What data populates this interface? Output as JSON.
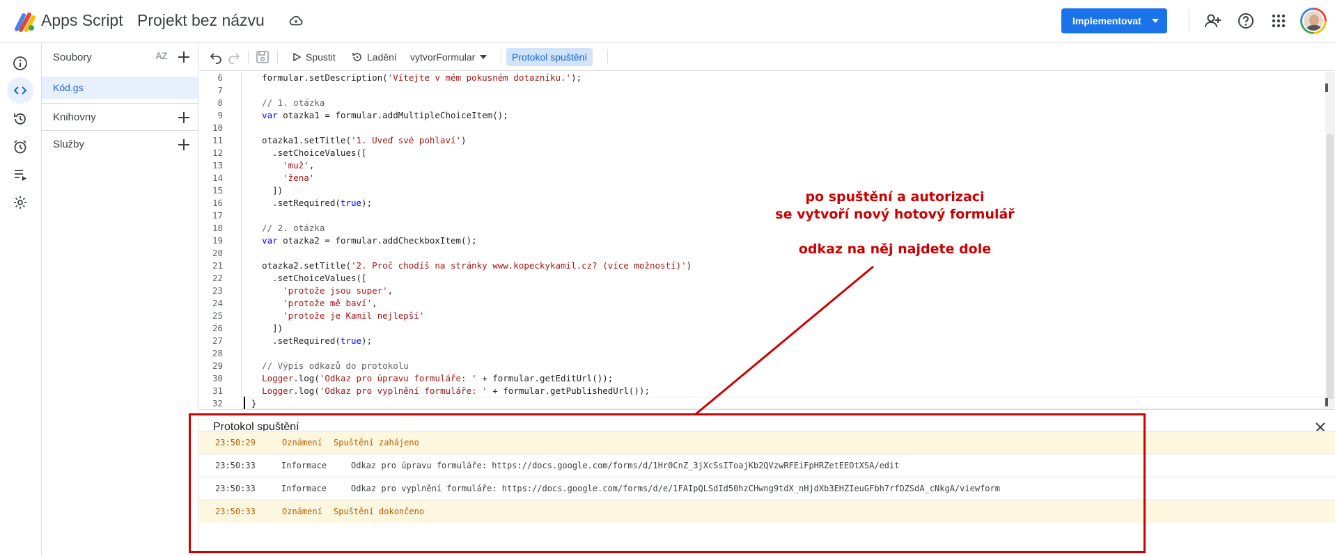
{
  "topbar": {
    "app_name": "Apps Script",
    "project_title": "Projekt bez názvu",
    "deploy_label": "Implementovat"
  },
  "colors": {
    "accent": "#1a73e8",
    "annotation": "#cc0000",
    "notice_row_bg": "#fef7e0",
    "notice_text": "#b06000",
    "string": "#a31515",
    "keyword": "#0000ff"
  },
  "rail": {
    "icons": [
      "info-icon",
      "code-icon",
      "history-icon",
      "alarm-icon",
      "executions-icon",
      "settings-icon"
    ]
  },
  "files": {
    "title": "Soubory",
    "sort_icon_text": "AZ",
    "items": [
      {
        "name": "Kód.gs"
      }
    ],
    "sections": [
      {
        "label": "Knihovny"
      },
      {
        "label": "Služby"
      }
    ]
  },
  "toolbar": {
    "run_label": "Spustit",
    "debug_label": "Ladění",
    "function_select": "vytvorFormular",
    "log_toggle_label": "Protokol spuštění"
  },
  "code": {
    "lines": [
      {
        "n": "6",
        "parts": [
          {
            "t": "  formular.setDescription(",
            "c": ""
          },
          {
            "t": "'Vítejte v mém pokusném dotazníku.'",
            "c": "str"
          },
          {
            "t": ");",
            "c": ""
          }
        ]
      },
      {
        "n": "7",
        "parts": []
      },
      {
        "n": "8",
        "parts": [
          {
            "t": "  // 1. otázka",
            "c": "cmt"
          }
        ]
      },
      {
        "n": "9",
        "parts": [
          {
            "t": "  ",
            "c": ""
          },
          {
            "t": "var",
            "c": "kw"
          },
          {
            "t": " otazka1 = formular.addMultipleChoiceItem();",
            "c": ""
          }
        ]
      },
      {
        "n": "10",
        "parts": []
      },
      {
        "n": "11",
        "parts": [
          {
            "t": "  otazka1.setTitle(",
            "c": ""
          },
          {
            "t": "'1. Uveď své pohlaví'",
            "c": "str"
          },
          {
            "t": ")",
            "c": ""
          }
        ]
      },
      {
        "n": "12",
        "parts": [
          {
            "t": "    .setChoiceValues([",
            "c": ""
          }
        ]
      },
      {
        "n": "13",
        "parts": [
          {
            "t": "      ",
            "c": ""
          },
          {
            "t": "'muž'",
            "c": "str"
          },
          {
            "t": ",",
            "c": ""
          }
        ]
      },
      {
        "n": "14",
        "parts": [
          {
            "t": "      ",
            "c": ""
          },
          {
            "t": "'žena'",
            "c": "str"
          }
        ]
      },
      {
        "n": "15",
        "parts": [
          {
            "t": "    ])",
            "c": ""
          }
        ]
      },
      {
        "n": "16",
        "parts": [
          {
            "t": "    .setRequired(",
            "c": ""
          },
          {
            "t": "true",
            "c": "kw"
          },
          {
            "t": ");",
            "c": ""
          }
        ]
      },
      {
        "n": "17",
        "parts": []
      },
      {
        "n": "18",
        "parts": [
          {
            "t": "  // 2. otázka",
            "c": "cmt"
          }
        ]
      },
      {
        "n": "19",
        "parts": [
          {
            "t": "  ",
            "c": ""
          },
          {
            "t": "var",
            "c": "kw"
          },
          {
            "t": " otazka2 = formular.addCheckboxItem();",
            "c": ""
          }
        ]
      },
      {
        "n": "20",
        "parts": []
      },
      {
        "n": "21",
        "parts": [
          {
            "t": "  otazka2.setTitle(",
            "c": ""
          },
          {
            "t": "'2. Proč chodíš na stránky www.kopeckykamil.cz? (více možností)'",
            "c": "str"
          },
          {
            "t": ")",
            "c": ""
          }
        ]
      },
      {
        "n": "22",
        "parts": [
          {
            "t": "    .setChoiceValues([",
            "c": ""
          }
        ]
      },
      {
        "n": "23",
        "parts": [
          {
            "t": "      ",
            "c": ""
          },
          {
            "t": "'protože jsou super'",
            "c": "str"
          },
          {
            "t": ",",
            "c": ""
          }
        ]
      },
      {
        "n": "24",
        "parts": [
          {
            "t": "      ",
            "c": ""
          },
          {
            "t": "'protože mě baví'",
            "c": "str"
          },
          {
            "t": ",",
            "c": ""
          }
        ]
      },
      {
        "n": "25",
        "parts": [
          {
            "t": "      ",
            "c": ""
          },
          {
            "t": "'protože je Kamil nejlepší'",
            "c": "str"
          }
        ]
      },
      {
        "n": "26",
        "parts": [
          {
            "t": "    ])",
            "c": ""
          }
        ]
      },
      {
        "n": "27",
        "parts": [
          {
            "t": "    .setRequired(",
            "c": ""
          },
          {
            "t": "true",
            "c": "kw"
          },
          {
            "t": ");",
            "c": ""
          }
        ]
      },
      {
        "n": "28",
        "parts": []
      },
      {
        "n": "29",
        "parts": [
          {
            "t": "  // Výpis odkazů do protokolu",
            "c": "cmt"
          }
        ]
      },
      {
        "n": "30",
        "parts": [
          {
            "t": "  ",
            "c": ""
          },
          {
            "t": "Logger",
            "c": "str"
          },
          {
            "t": ".log(",
            "c": ""
          },
          {
            "t": "'Odkaz pro úpravu formuláře: '",
            "c": "str"
          },
          {
            "t": " + formular.getEditUrl());",
            "c": ""
          }
        ]
      },
      {
        "n": "31",
        "parts": [
          {
            "t": "  ",
            "c": ""
          },
          {
            "t": "Logger",
            "c": "str"
          },
          {
            "t": ".log(",
            "c": ""
          },
          {
            "t": "'Odkaz pro vyplnění formuláře: '",
            "c": "str"
          },
          {
            "t": " + formular.getPublishedUrl());",
            "c": ""
          }
        ]
      },
      {
        "n": "32",
        "parts": [
          {
            "t": "}",
            "c": ""
          }
        ]
      }
    ]
  },
  "log": {
    "title": "Protokol spuštění",
    "rows": [
      {
        "time": "23:50:29",
        "type": "Oznámení",
        "message": "Spuštění zahájeno",
        "kind": "notice"
      },
      {
        "time": "23:50:33",
        "type": "Informace",
        "message": "Odkaz pro úpravu formuláře: https://docs.google.com/forms/d/1Hr0CnZ_3jXcSsIToajKb2QVzwRFEiFpHRZetEEOtXSA/edit",
        "kind": "info"
      },
      {
        "time": "23:50:33",
        "type": "Informace",
        "message": "Odkaz pro vyplnění formuláře: https://docs.google.com/forms/d/e/1FAIpQLSdId50hzCHwng9tdX_nHjdXb3EHZIeuGFbh7rfDZSdA_cNkgA/viewform",
        "kind": "info"
      },
      {
        "time": "23:50:33",
        "type": "Oznámení",
        "message": "Spuštění dokončeno",
        "kind": "notice"
      }
    ]
  },
  "annotation": {
    "line1": "po spuštění a autorizaci",
    "line2": "se vytvoří nový hotový formulář",
    "line3": "odkaz na něj najdete dole"
  }
}
